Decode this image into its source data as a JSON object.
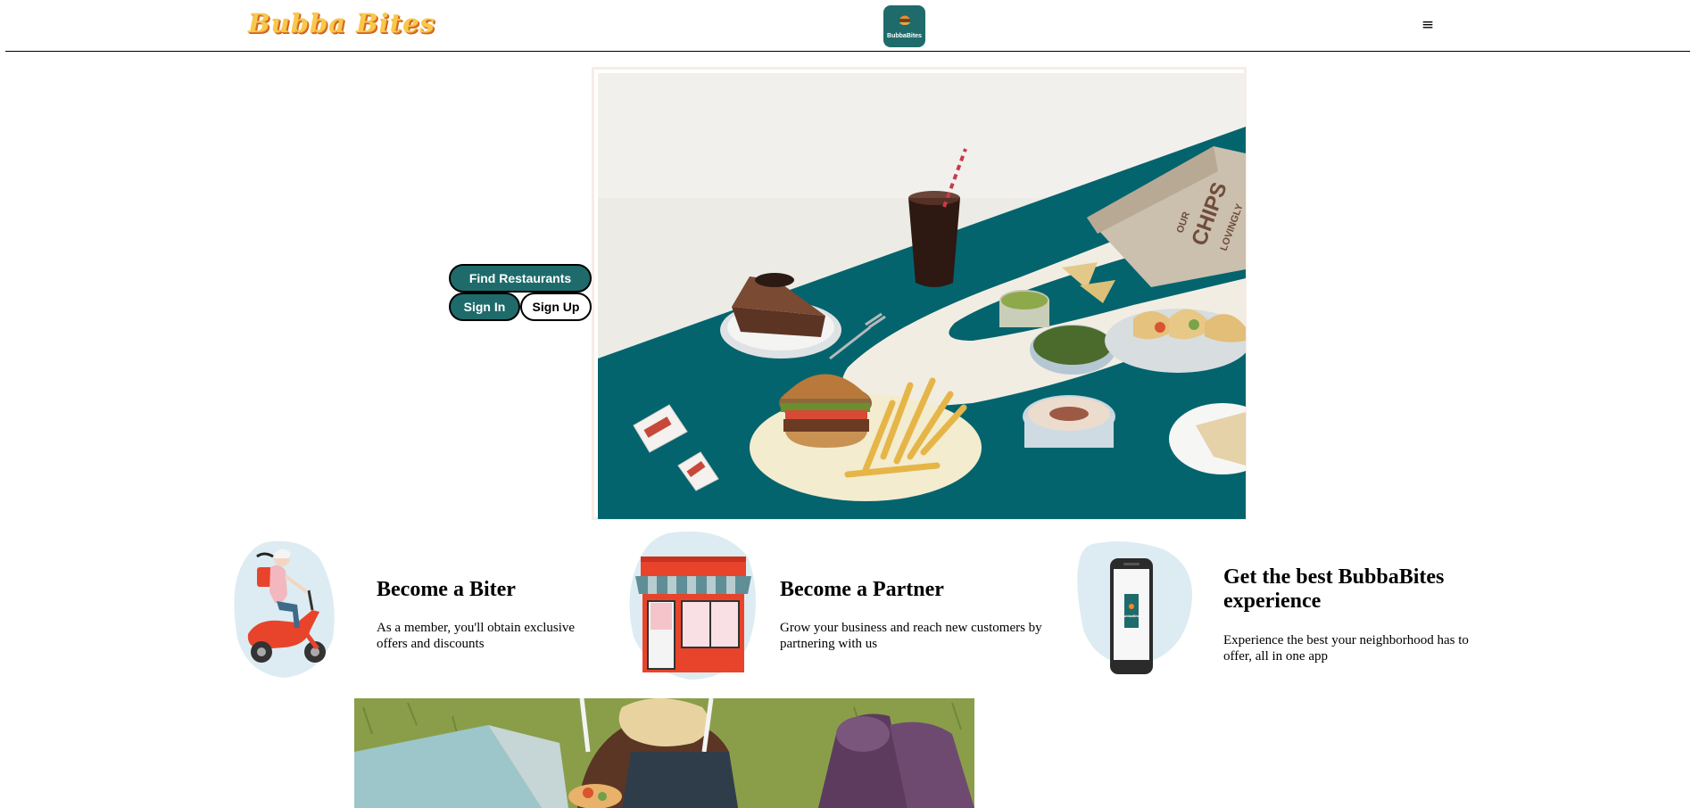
{
  "header": {
    "brand_wordmark": "Bubba Bites",
    "logo_text": "BubbaBites",
    "menu_glyph": "≡"
  },
  "hero": {
    "buttons": {
      "find_restaurants": "Find Restaurants",
      "sign_in": "Sign In",
      "sign_up": "Sign Up"
    },
    "image_text": {
      "bag_text_1": "OUR",
      "bag_text_2": "CHIPS",
      "bag_text_3": "LOVINGLY"
    }
  },
  "features": [
    {
      "icon": "scooter-courier-icon",
      "title": "Become a Biter",
      "description": "As a member, you'll obtain exclusive offers and discounts"
    },
    {
      "icon": "storefront-icon",
      "title": "Become a Partner",
      "description": "Grow your business and reach new customers by partnering with us"
    },
    {
      "icon": "phone-app-icon",
      "title": "Get the best BubbaBites experience",
      "description": "Experience the best your neighborhood has to offer, all in one app",
      "phone_screen_text": "BubbaBites"
    }
  ],
  "colors": {
    "brand_teal": "#1f6b6b",
    "wordmark_yellow": "#f9c84a",
    "hero_table_teal": "#04646e",
    "accent_red": "#e8442c",
    "blob_blue": "#dcecf2"
  }
}
